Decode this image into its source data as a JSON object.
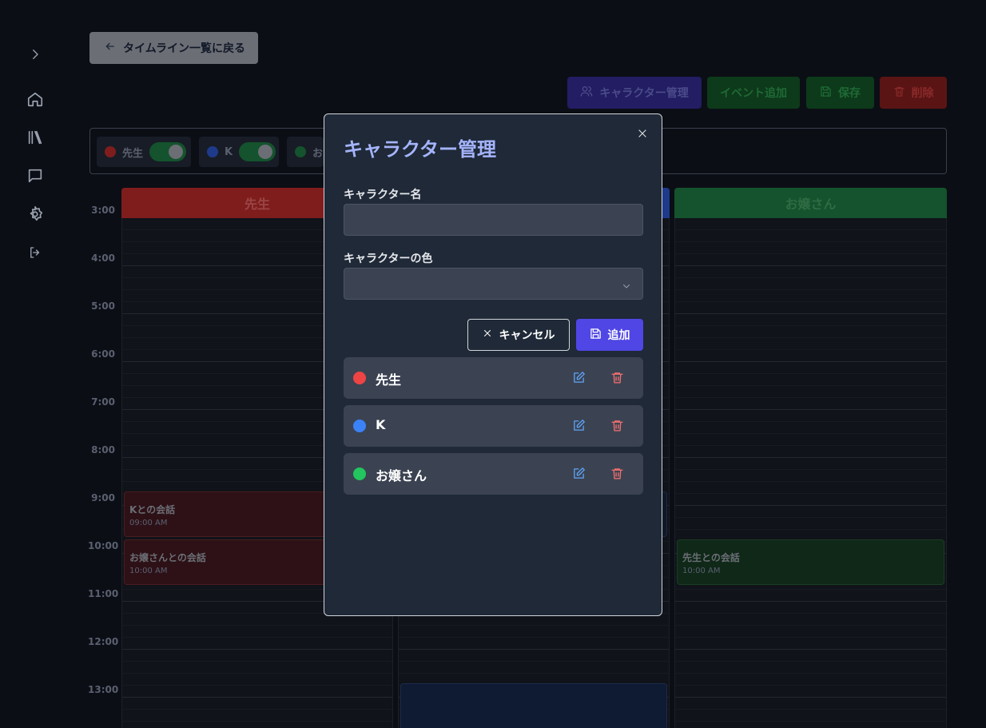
{
  "nav": {
    "back_label": "タイムライン一覧に戻る",
    "sidebar_icons": [
      "chevron-right-icon",
      "home-icon",
      "library-icon",
      "chat-icon",
      "settings-icon",
      "logout-icon"
    ]
  },
  "toolbar": {
    "character_manage": "キャラクター管理",
    "add_event": "イベント追加",
    "save": "保存",
    "delete": "削除"
  },
  "filters": [
    {
      "name": "先生",
      "color": "#ef4444",
      "enabled": true
    },
    {
      "name": "K",
      "color": "#3b82f6",
      "enabled": true
    },
    {
      "name": "お",
      "color": "#22c55e",
      "enabled": true
    }
  ],
  "timeline": {
    "hours": [
      "3:00",
      "4:00",
      "5:00",
      "6:00",
      "7:00",
      "8:00",
      "9:00",
      "10:00",
      "11:00",
      "12:00",
      "13:00"
    ],
    "columns": [
      {
        "name": "先生",
        "events": [
          {
            "title": "Kとの会話",
            "time": "09:00 AM"
          },
          {
            "title": "お嬢さんとの会話",
            "time": "10:00 AM"
          }
        ]
      },
      {
        "name": "",
        "events": []
      },
      {
        "name": "お嬢さん",
        "events": [
          {
            "title": "先生との会話",
            "time": "10:00 AM"
          }
        ]
      }
    ]
  },
  "modal": {
    "title": "キャラクター管理",
    "name_label": "キャラクター名",
    "name_value": "",
    "color_label": "キャラクターの色",
    "color_value": "",
    "cancel_label": "キャンセル",
    "add_label": "追加",
    "characters": [
      {
        "name": "先生",
        "color": "#ef4444"
      },
      {
        "name": "K",
        "color": "#3b82f6"
      },
      {
        "name": "お嬢さん",
        "color": "#22c55e"
      }
    ]
  }
}
